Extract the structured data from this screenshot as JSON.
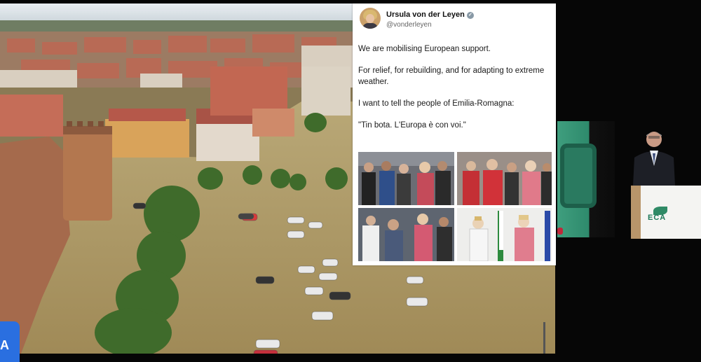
{
  "tweet": {
    "name": "Ursula von der Leyen",
    "handle": "@vonderleyen",
    "verified_icon": "check-icon",
    "paragraphs": [
      "We are mobilising European support.",
      "For relief, for rebuilding, and for adapting to extreme weather.",
      "I want to tell the people of Emilia-Romagna:",
      "\"Tin bota. L'Europa è con voi.\""
    ]
  },
  "badge": {
    "label": "A"
  },
  "colors": {
    "flood_water": "#a8925e",
    "roof": "#b5584a",
    "tree": "#3f6b2b",
    "eca_green": "#2e8a6c",
    "badge_blue": "#2a6fe0"
  }
}
